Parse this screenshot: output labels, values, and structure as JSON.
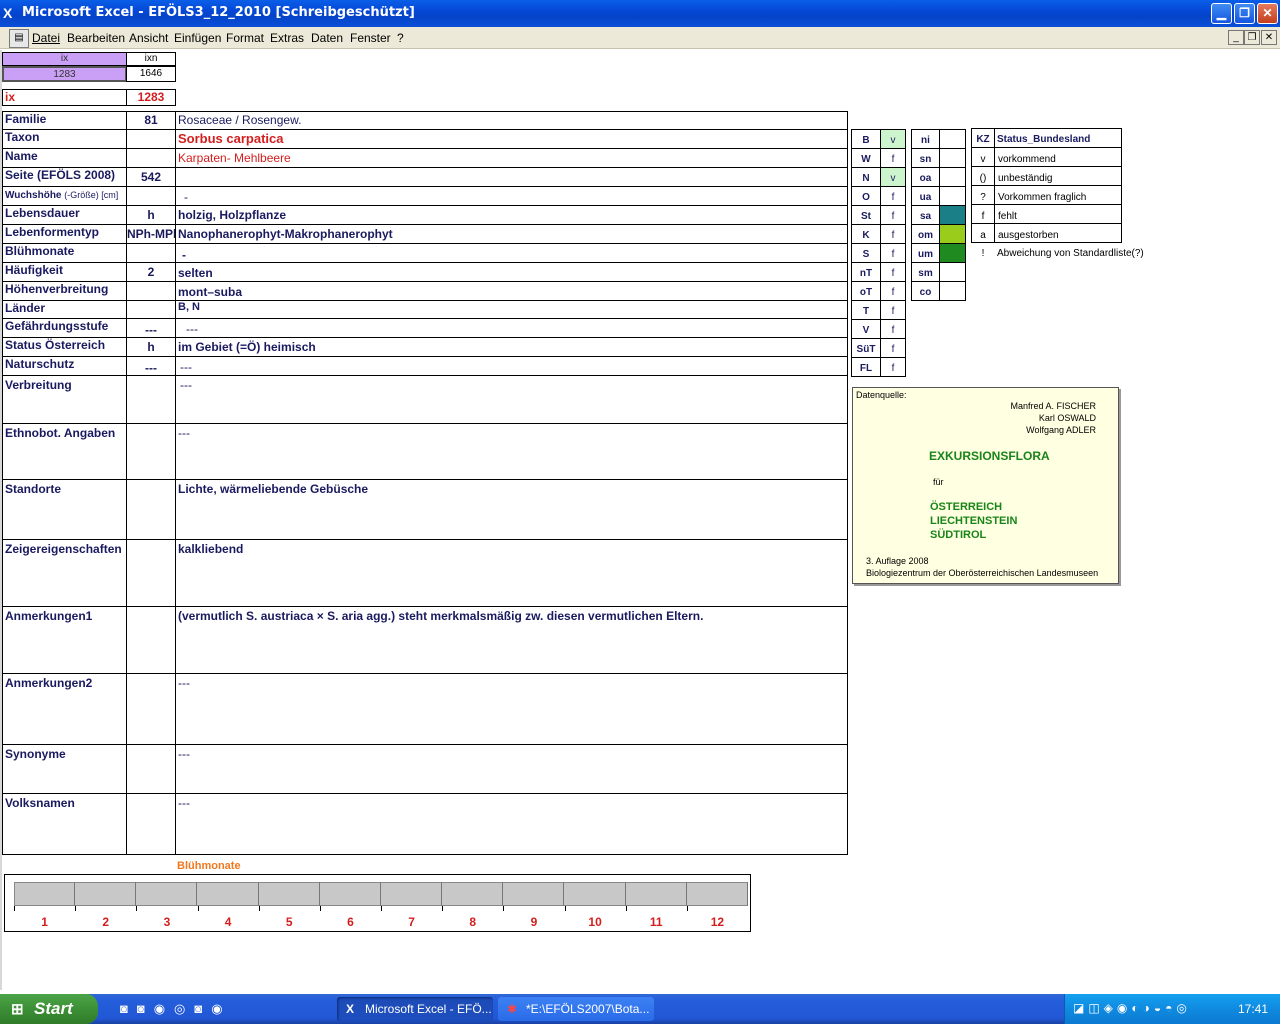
{
  "window": {
    "title": "Microsoft Excel - EFÖLS3_12_2010  [Schreibgeschützt]"
  },
  "menu": [
    "Datei",
    "Bearbeiten",
    "Ansicht",
    "Einfügen",
    "Format",
    "Extras",
    "Daten",
    "Fenster",
    "?"
  ],
  "top": {
    "ix_label": "ix",
    "ixn_label": "ixn",
    "ix_value": "1283",
    "ixn_value": "1646",
    "ix2_label": "ix",
    "ix2_value": "1283"
  },
  "rows": [
    {
      "label": "Familie",
      "code": "81",
      "value": "Rosaceae  /  Rosengew."
    },
    {
      "label": "Taxon",
      "code": "",
      "value": "Sorbus carpatica"
    },
    {
      "label": "Name",
      "code": "",
      "value": "Karpaten- Mehlbeere"
    },
    {
      "label": "Seite (EFÖLS 2008)",
      "code": "542",
      "value": ""
    },
    {
      "label": "Wuchshöhe",
      "label_extra": "(-Größe) [cm]",
      "code": "",
      "value": "-"
    },
    {
      "label": "Lebensdauer",
      "code": "h",
      "value": "holzig, Holzpflanze"
    },
    {
      "label": "Lebenformentyp",
      "code": "NPh-MPh",
      "value": "Nanophanerophyt-Makrophanerophyt"
    },
    {
      "label": "Blühmonate",
      "code": "",
      "value": "-"
    },
    {
      "label": "Häufigkeit",
      "code": "2",
      "value": "selten"
    },
    {
      "label": "Höhenverbreitung",
      "code": "",
      "value": "mont–suba"
    },
    {
      "label": "Länder",
      "code": "",
      "value": "B, N"
    },
    {
      "label": "Gefährdungsstufe",
      "code": "---",
      "value": "---"
    },
    {
      "label": "Status Österreich",
      "code": "h",
      "value": "im Gebiet (=Ö) heimisch"
    },
    {
      "label": "Naturschutz",
      "code": "---",
      "value": "---"
    },
    {
      "label": "Verbreitung",
      "code": "",
      "value": "---"
    },
    {
      "label": "Ethnobot. Angaben",
      "code": "",
      "value": "---"
    },
    {
      "label": "Standorte",
      "code": "",
      "value": "Lichte, wärmeliebende Gebüsche"
    },
    {
      "label": "Zeigereigenschaften",
      "code": "",
      "value": "kalkliebend"
    },
    {
      "label": "Anmerkungen1",
      "code": "",
      "value": "(vermutlich S. austriaca × S. aria agg.) steht merkmalsmäßig zw. diesen vermutlichen Eltern."
    },
    {
      "label": "Anmerkungen2",
      "code": "",
      "value": "---"
    },
    {
      "label": "Synonyme",
      "code": "",
      "value": "---"
    },
    {
      "label": "Volksnamen",
      "code": "",
      "value": "---"
    }
  ],
  "states": [
    {
      "code": "B",
      "status": "v"
    },
    {
      "code": "W",
      "status": "f"
    },
    {
      "code": "N",
      "status": "v"
    },
    {
      "code": "O",
      "status": "f"
    },
    {
      "code": "St",
      "status": "f"
    },
    {
      "code": "K",
      "status": "f"
    },
    {
      "code": "S",
      "status": "f"
    },
    {
      "code": "nT",
      "status": "f"
    },
    {
      "code": "oT",
      "status": "f"
    },
    {
      "code": "T",
      "status": "f"
    },
    {
      "code": "V",
      "status": "f"
    },
    {
      "code": "SüT",
      "status": "f"
    },
    {
      "code": "FL",
      "status": "f"
    }
  ],
  "regions": [
    "ni",
    "sn",
    "oa",
    "ua",
    "sa",
    "om",
    "um",
    "sm",
    "co"
  ],
  "region_colors": {
    "sa": "#1a7f86",
    "om": "#9acd1b",
    "um": "#1f8a1f"
  },
  "highlight_color": "#cdf5cd",
  "legend": {
    "header_kz": "KZ",
    "header_status": "Status_Bundesland",
    "items": [
      {
        "kz": "v",
        "text": "vorkommend"
      },
      {
        "kz": "()",
        "text": "unbeständig"
      },
      {
        "kz": "?",
        "text": "Vorkommen fraglich"
      },
      {
        "kz": "f",
        "text": "fehlt"
      },
      {
        "kz": "a",
        "text": "ausgestorben"
      },
      {
        "kz": "!",
        "text": "Abweichung von Standardliste(?)"
      }
    ]
  },
  "source": {
    "label": "Datenquelle:",
    "authors": [
      "Manfred A. FISCHER",
      "Karl OSWALD",
      "Wolfgang ADLER"
    ],
    "title": "EXKURSIONSFLORA",
    "fuer": "für",
    "countries": [
      "ÖSTERREICH",
      "LIECHTENSTEIN",
      "SÜDTIROL"
    ],
    "edition": "3. Auflage 2008",
    "publisher": "Biologiezentrum der Oberösterreichischen Landesmuseen"
  },
  "bluehmonate": {
    "title": "Blühmonate",
    "months": [
      "1",
      "2",
      "3",
      "4",
      "5",
      "6",
      "7",
      "8",
      "9",
      "10",
      "11",
      "12"
    ]
  },
  "taskbar": {
    "start": "Start",
    "tasks": [
      "Microsoft Excel - EFÖ...",
      "*E:\\EFÖLS2007\\Bota..."
    ],
    "clock": "17:41"
  }
}
